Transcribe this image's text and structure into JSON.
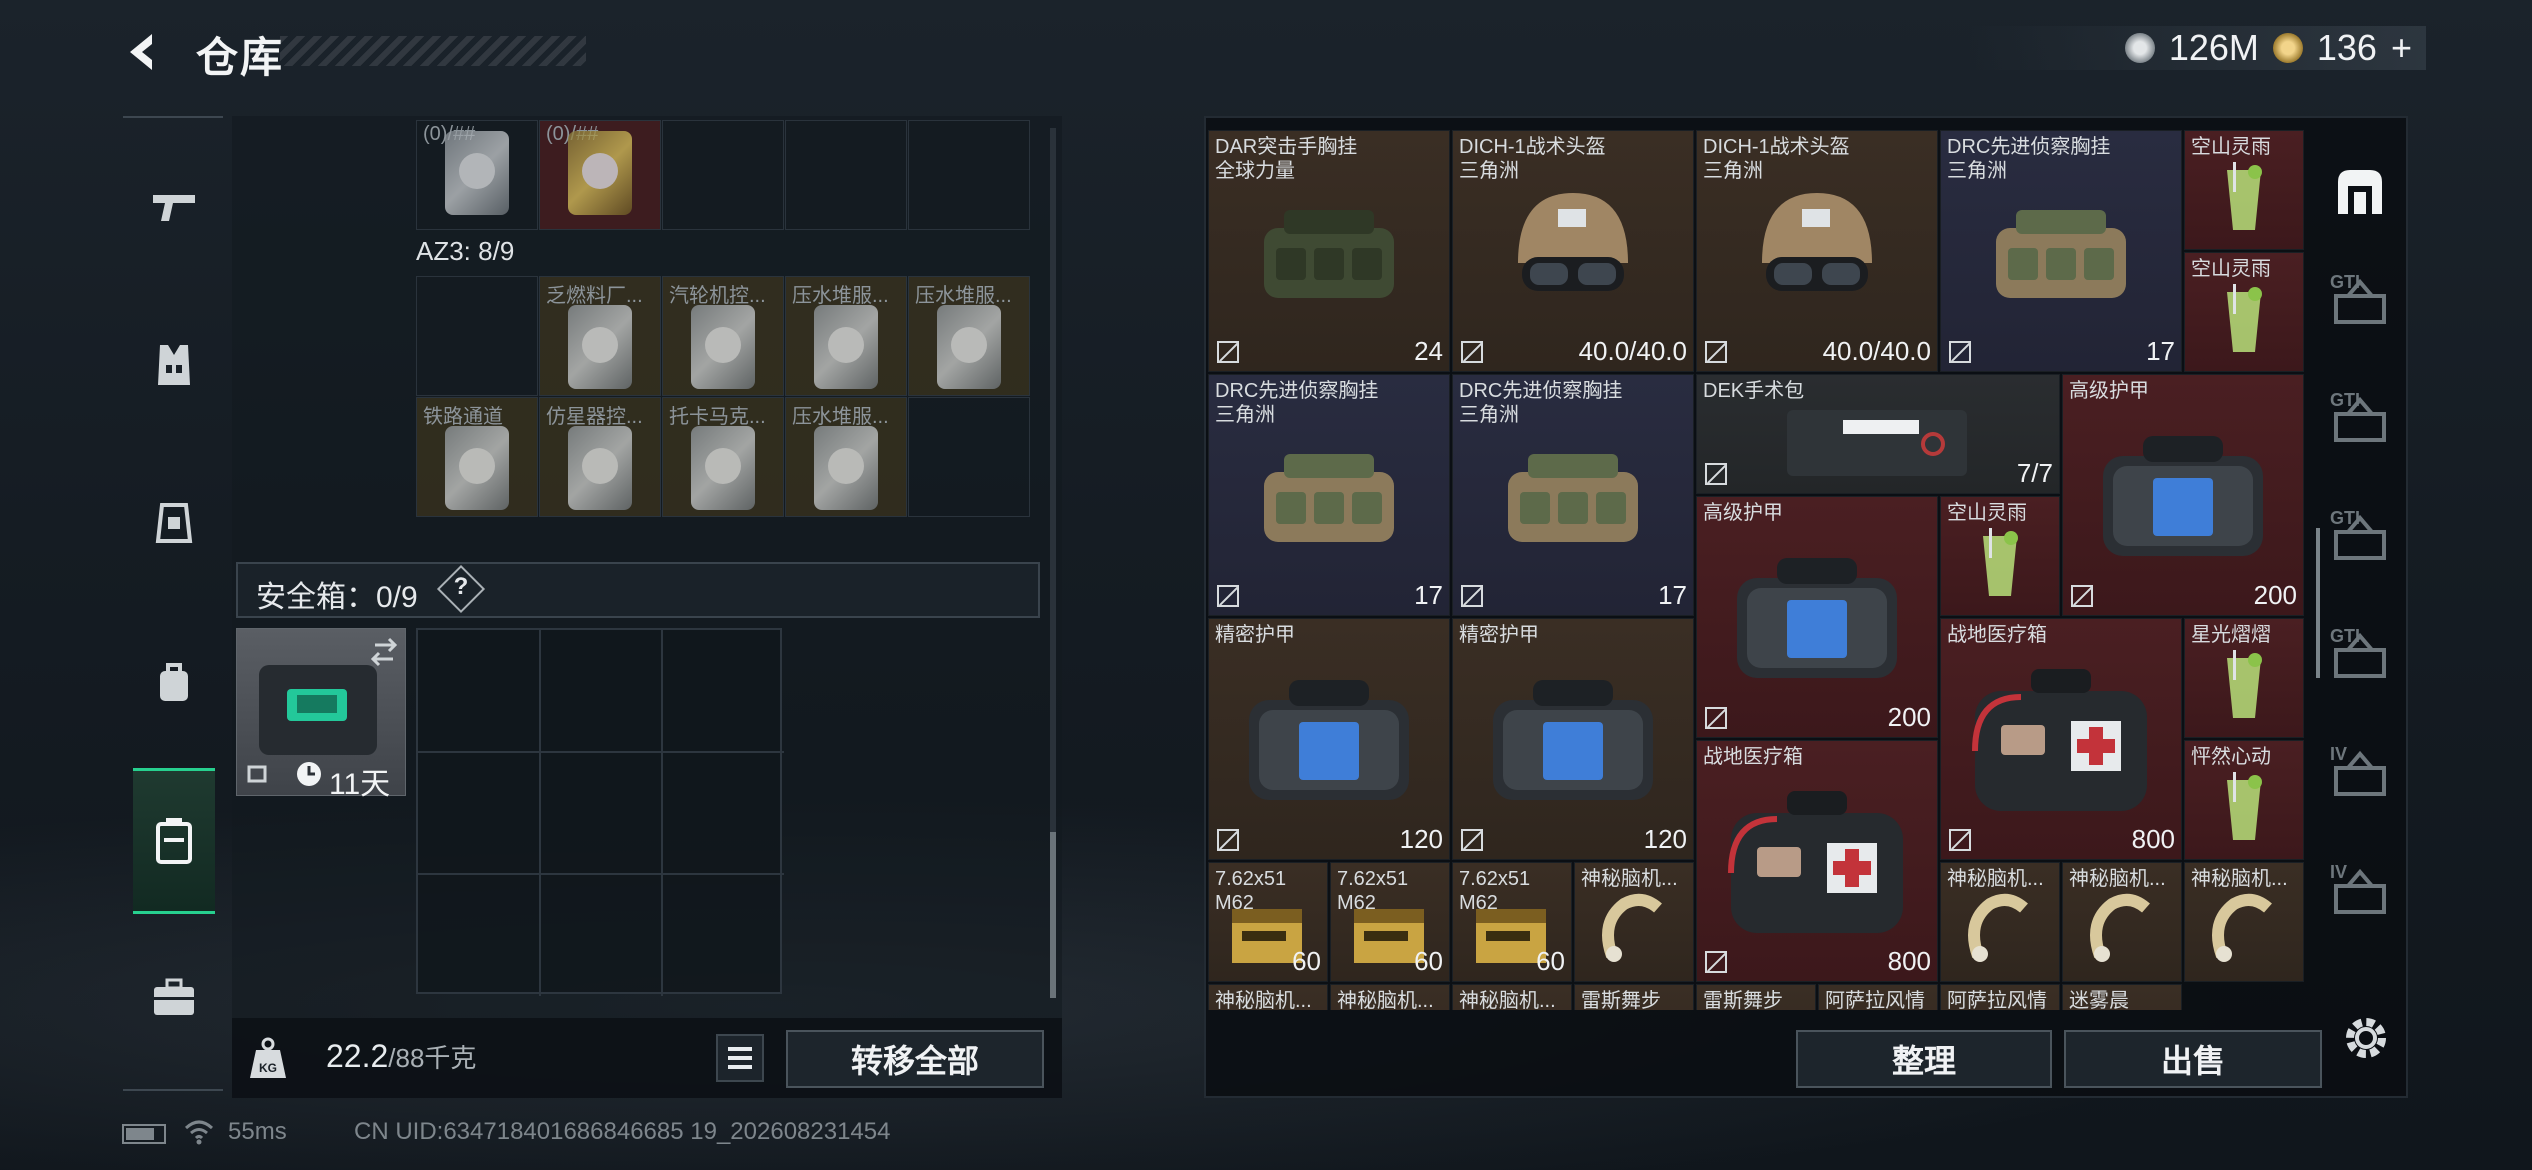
{
  "header": {
    "title": "仓库"
  },
  "currency": {
    "silver": "126M",
    "gold": "136",
    "plus": "+"
  },
  "left_nav": {
    "icons": [
      "gun-icon",
      "vest-icon",
      "armor-icon",
      "backpack-icon",
      "safebox-icon",
      "briefcase-icon"
    ],
    "selected": 4
  },
  "container": {
    "top_row_partial": [
      "(0)/##",
      "(0)/##"
    ],
    "az3_label": "AZ3: 8/9",
    "az3_items": [
      {
        "name": "",
        "color": "dark"
      },
      {
        "name": "乏燃料厂...",
        "color": "yel"
      },
      {
        "name": "汽轮机控...",
        "color": "yel"
      },
      {
        "name": "压水堆服...",
        "color": "yel"
      },
      {
        "name": "压水堆服...",
        "color": "yel"
      },
      {
        "name": "铁路通道",
        "color": "yel"
      },
      {
        "name": "仿星器控...",
        "color": "yel"
      },
      {
        "name": "托卡马克...",
        "color": "yel"
      },
      {
        "name": "压水堆服...",
        "color": "yel"
      },
      {
        "name": "",
        "color": "dark"
      }
    ]
  },
  "safe": {
    "label": "安全箱：0/9",
    "help": "?",
    "duration": "11天"
  },
  "weight": {
    "current": "22.2",
    "max": "/88千克"
  },
  "buttons": {
    "transfer_all": "转移全部",
    "sort": "整理",
    "sell": "出售"
  },
  "footer": {
    "ping": "55ms",
    "uid": "CN UID:634718401686846685 19_202608231454"
  },
  "stash_items": [
    {
      "name": "DAR突击手胸挂\n全球力量",
      "value": "24",
      "color": "brown",
      "icon": "vest-icon"
    },
    {
      "name": "DICH-1战术头盔\n三角洲",
      "value": "40.0/40.0",
      "color": "brown",
      "icon": "helmet-icon"
    },
    {
      "name": "DICH-1战术头盔\n三角洲",
      "value": "40.0/40.0",
      "color": "brown",
      "icon": "helmet-icon"
    },
    {
      "name": "DRC先进侦察胸挂\n三角洲",
      "value": "17",
      "color": "navy",
      "icon": "vest-icon"
    },
    {
      "name": "空山灵雨",
      "value": "",
      "color": "red",
      "icon": "drink-icon"
    },
    {
      "name": "空山灵雨",
      "value": "",
      "color": "red",
      "icon": "drink-icon"
    },
    {
      "name": "DRC先进侦察胸挂\n三角洲",
      "value": "17",
      "color": "navy",
      "icon": "vest-icon"
    },
    {
      "name": "DRC先进侦察胸挂\n三角洲",
      "value": "17",
      "color": "navy",
      "icon": "vest-icon"
    },
    {
      "name": "DEK手术包",
      "value": "7/7",
      "color": "dark",
      "icon": "medkit-icon"
    },
    {
      "name": "高级护甲",
      "value": "200",
      "color": "red",
      "icon": "armor-icon"
    },
    {
      "name": "高级护甲",
      "value": "200",
      "color": "red",
      "icon": "armor-icon"
    },
    {
      "name": "空山灵雨",
      "value": "",
      "color": "red",
      "icon": "drink-icon"
    },
    {
      "name": "精密护甲",
      "value": "120",
      "color": "brown",
      "icon": "armor-icon"
    },
    {
      "name": "精密护甲",
      "value": "120",
      "color": "brown",
      "icon": "armor-icon"
    },
    {
      "name": "战地医疗箱",
      "value": "800",
      "color": "red",
      "icon": "firstaid-icon"
    },
    {
      "name": "星光熠熠",
      "value": "",
      "color": "red",
      "icon": "drink-icon"
    },
    {
      "name": "战地医疗箱",
      "value": "800",
      "color": "red",
      "icon": "firstaid-icon"
    },
    {
      "name": "怦然心动",
      "value": "",
      "color": "red",
      "icon": "drink-icon"
    },
    {
      "name": "7.62x51\nM62",
      "value": "60",
      "color": "brown",
      "icon": "ammo-icon"
    },
    {
      "name": "7.62x51\nM62",
      "value": "60",
      "color": "brown",
      "icon": "ammo-icon"
    },
    {
      "name": "7.62x51\nM62",
      "value": "60",
      "color": "brown",
      "icon": "ammo-icon"
    },
    {
      "name": "神秘脑机...",
      "value": "",
      "color": "brown",
      "icon": "device-icon"
    },
    {
      "name": "神秘脑机...",
      "value": "",
      "color": "brown",
      "icon": "device-icon"
    },
    {
      "name": "神秘脑机...",
      "value": "",
      "color": "brown",
      "icon": "device-icon"
    },
    {
      "name": "神秘脑机...",
      "value": "",
      "color": "brown",
      "icon": "device-icon"
    },
    {
      "name": "神秘脑机...",
      "value": "",
      "color": "brown",
      "icon": "device-icon"
    },
    {
      "name": "神秘脑机...",
      "value": "",
      "color": "brown",
      "icon": "device-icon"
    },
    {
      "name": "神秘脑机...",
      "value": "",
      "color": "brown",
      "icon": "device-icon"
    },
    {
      "name": "雷斯舞步",
      "value": "",
      "color": "brown",
      "icon": "drink-icon"
    },
    {
      "name": "雷斯舞步",
      "value": "",
      "color": "brown",
      "icon": "drink-icon"
    },
    {
      "name": "阿萨拉风情",
      "value": "",
      "color": "brown",
      "icon": "drink-icon"
    },
    {
      "name": "阿萨拉风情",
      "value": "",
      "color": "brown",
      "icon": "drink-icon"
    },
    {
      "name": "迷雾晨",
      "value": "",
      "color": "brown",
      "icon": "drink-icon"
    }
  ],
  "right_nav": {
    "labels": [
      "GTI",
      "GTI",
      "GTI",
      "GTI",
      "IV",
      "IV"
    ]
  }
}
